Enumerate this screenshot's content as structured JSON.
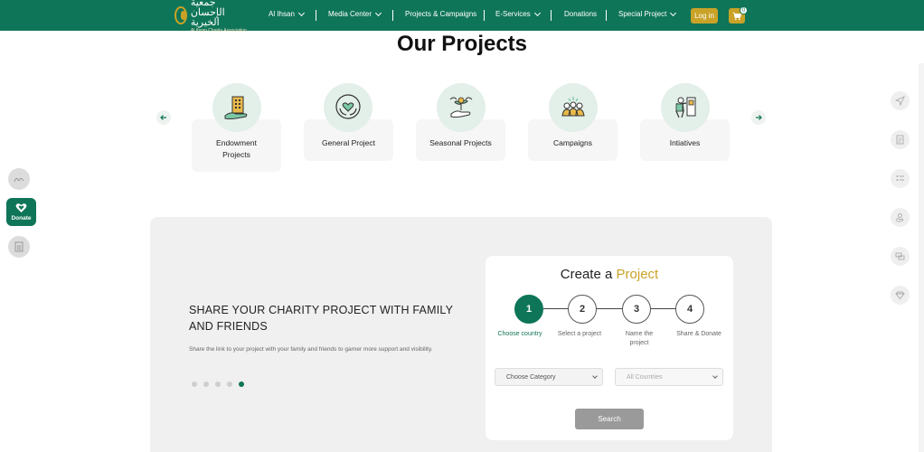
{
  "nav": {
    "logo_arabic": "جمعية الإحسان الخيرية",
    "logo_english": "Al Ihsan Charity Association",
    "items": [
      {
        "label": "Al Ihsan",
        "dropdown": true
      },
      {
        "label": "Media Center",
        "dropdown": true
      },
      {
        "label": "Projects & Campaigns",
        "dropdown": false
      },
      {
        "label": "E-Services",
        "dropdown": true
      },
      {
        "label": "Donations",
        "dropdown": false
      },
      {
        "label": "Special Project",
        "dropdown": true
      }
    ],
    "login_label": "Log in",
    "cart_count": "0",
    "brand_color": "#0f7558",
    "accent_color": "#c9a227"
  },
  "page_title": "Our Projects",
  "projects": [
    {
      "label_line1": "Endowment",
      "label_line2": "Projects",
      "icon": "building-hand-icon"
    },
    {
      "label_line1": "General Project",
      "label_line2": "",
      "icon": "heart-hands-icon"
    },
    {
      "label_line1": "Seasonal Projects",
      "label_line2": "",
      "icon": "plant-hand-icon"
    },
    {
      "label_line1": "Campaigns",
      "label_line2": "",
      "icon": "people-group-icon"
    },
    {
      "label_line1": "Intiatives",
      "label_line2": "",
      "icon": "worker-icon"
    }
  ],
  "share": {
    "title": "SHARE YOUR CHARITY PROJECT WITH FAMILY AND FRIENDS",
    "description": "Share the link to your project with your family and friends to garner more support and visibility.",
    "slide_count": 5,
    "active_slide": 5
  },
  "create": {
    "title_prefix": "Create a",
    "title_highlight": "Project",
    "steps": [
      {
        "number": "1",
        "label": "Choose country",
        "active": true
      },
      {
        "number": "2",
        "label": "Select a project",
        "active": false
      },
      {
        "number": "3",
        "label": "Name the project",
        "active": false
      },
      {
        "number": "4",
        "label": "Share & Donate",
        "active": false
      }
    ],
    "category_select": "Choose Category",
    "country_select": "All Countries",
    "search_label": "Search"
  },
  "side": {
    "donate_label": "Donate"
  }
}
